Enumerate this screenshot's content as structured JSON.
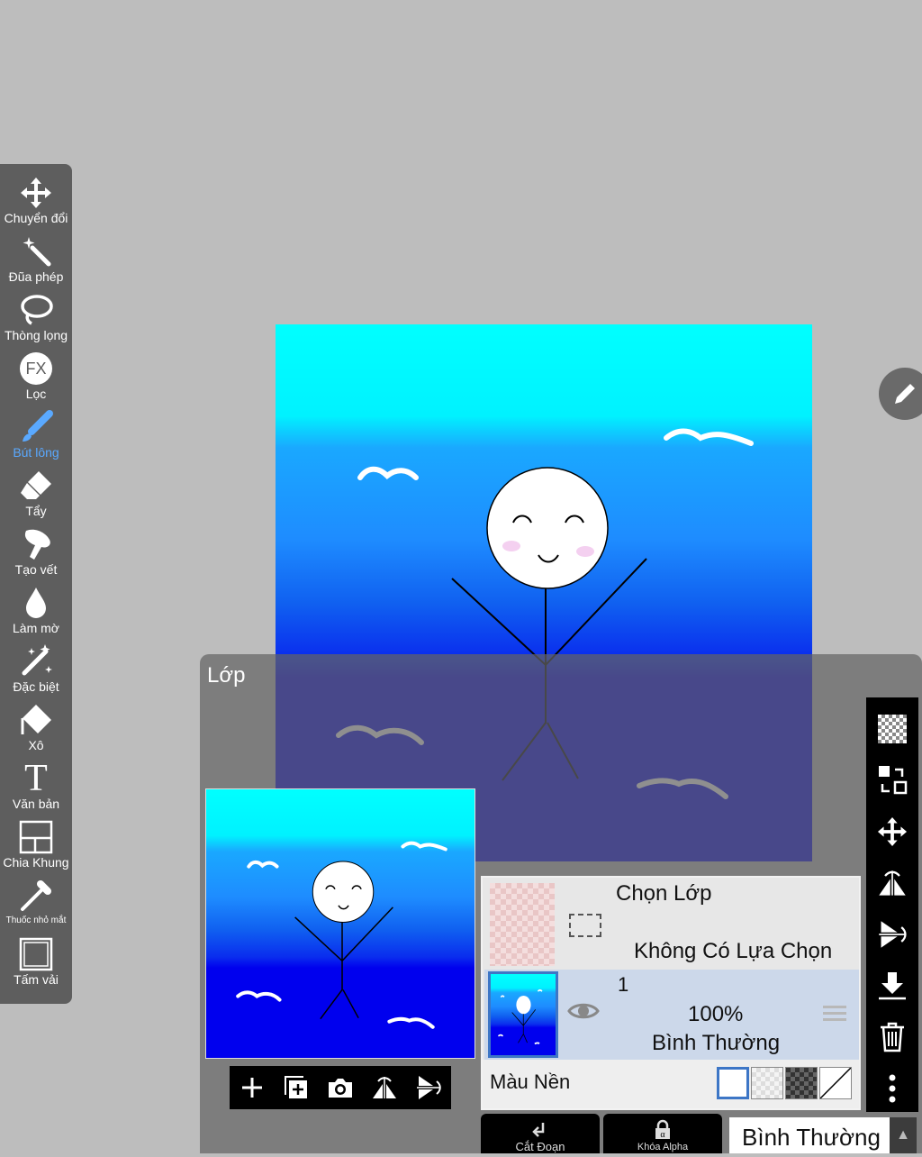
{
  "toolbar": {
    "items": [
      {
        "label": "Chuyển đổi",
        "icon": "move-arrows-icon"
      },
      {
        "label": "Đũa phép",
        "icon": "magic-wand-icon"
      },
      {
        "label": "Thòng lọng",
        "icon": "lasso-icon"
      },
      {
        "label": "Lọc",
        "icon": "fx-filter-icon",
        "badge": "FX"
      },
      {
        "label": "Bút lông",
        "icon": "brush-icon",
        "active": true
      },
      {
        "label": "Tẩy",
        "icon": "eraser-icon"
      },
      {
        "label": "Tạo vết",
        "icon": "smudge-icon"
      },
      {
        "label": "Làm mờ",
        "icon": "blur-drop-icon"
      },
      {
        "label": "Đặc biệt",
        "icon": "special-brush-icon"
      },
      {
        "label": "Xô",
        "icon": "bucket-icon"
      },
      {
        "label": "Văn bản",
        "icon": "text-icon",
        "glyph": "T"
      },
      {
        "label": "Chia Khung",
        "icon": "frame-divider-icon"
      },
      {
        "label": "Thuốc nhỏ mắt",
        "icon": "eyedropper-icon"
      },
      {
        "label": "Tấm vải",
        "icon": "canvas-icon"
      }
    ],
    "active_color": "#5aa9ff"
  },
  "layer_panel": {
    "title": "Lớp",
    "selection_layer": {
      "title": "Chọn Lớp",
      "subtitle": "Không Có Lựa Chọn"
    },
    "layer1": {
      "name": "1",
      "opacity": "100%",
      "blend": "Bình Thường"
    },
    "background": {
      "label": "Màu Nền"
    },
    "bottom_bar": {
      "clipping_label": "Cắt Đoạn",
      "alpha_lock_label": "Khóa Alpha",
      "blend_mode": "Bình Thường"
    }
  },
  "colors": {
    "sky_top": "#00ffff",
    "sky_mid": "#1e90ff",
    "deep_blue": "#0000ee",
    "selected_layer_border": "#3d76c6"
  }
}
